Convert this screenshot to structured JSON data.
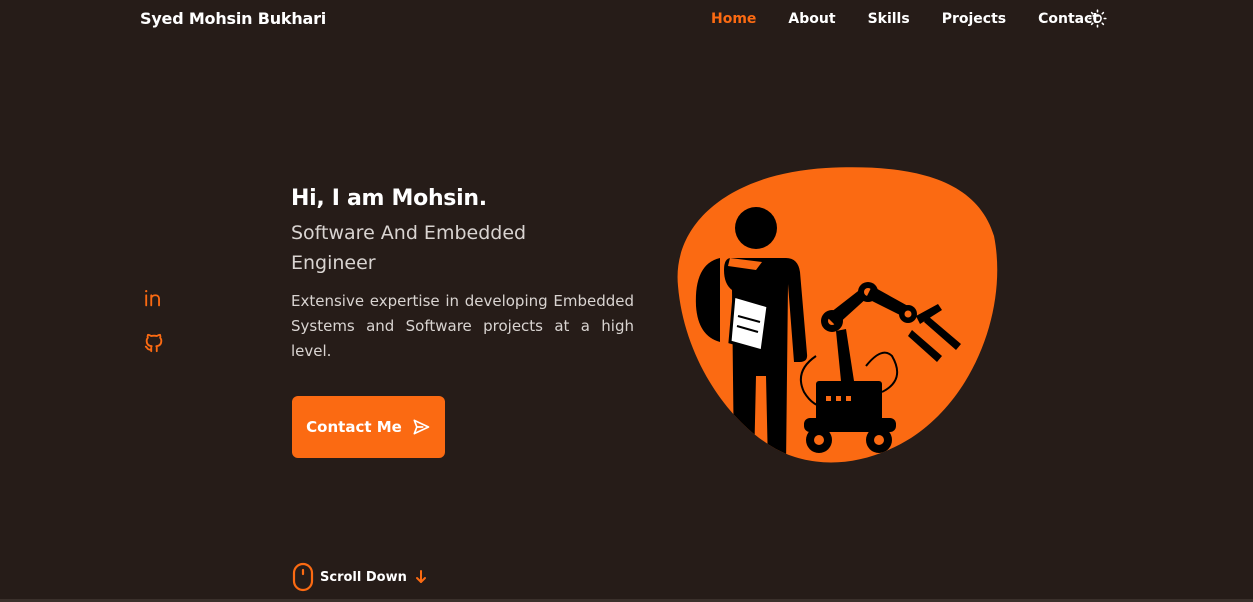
{
  "header": {
    "brand": "Syed Mohsin Bukhari",
    "nav": [
      {
        "label": "Home",
        "active": true
      },
      {
        "label": "About"
      },
      {
        "label": "Skills"
      },
      {
        "label": "Projects"
      },
      {
        "label": "Contact"
      }
    ],
    "theme_icon": "sun-icon"
  },
  "social": [
    {
      "icon": "linkedin-icon"
    },
    {
      "icon": "github-icon"
    }
  ],
  "hero": {
    "title": "Hi, I am Mohsin.",
    "subtitle": "Software And Embedded Engineer",
    "description": "Extensive expertise in developing Embedded Systems and Software projects at a high level.",
    "button_label": "Contact Me",
    "button_icon": "send-icon",
    "illustration": "engineer-with-robot-arm"
  },
  "scroll": {
    "label": "Scroll Down",
    "icons": [
      "mouse-icon",
      "arrow-down-icon"
    ]
  },
  "colors": {
    "background": "#261c18",
    "accent": "#fb6a12",
    "text": "#ffffff",
    "muted_text": "#d9d4d1"
  }
}
